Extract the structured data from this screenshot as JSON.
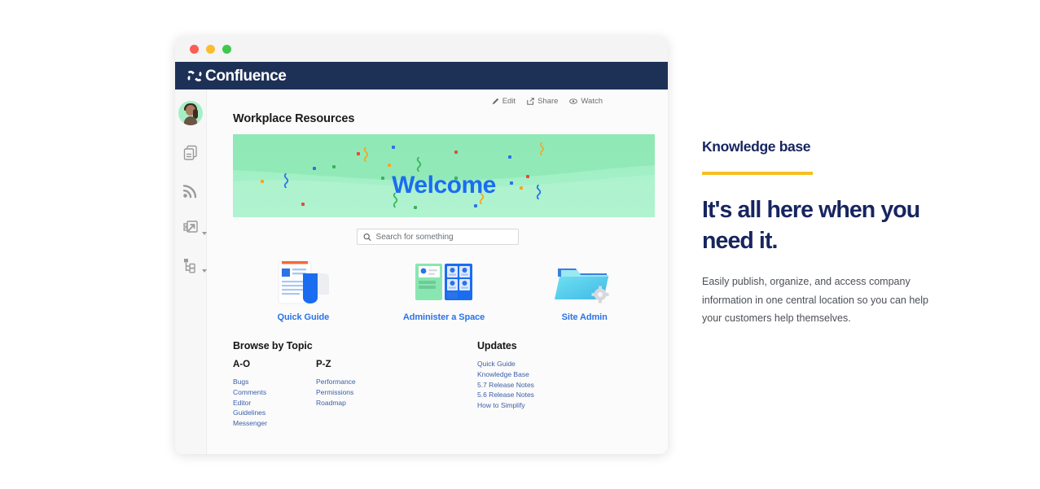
{
  "window": {
    "traffic_lights": [
      "close",
      "minimize",
      "maximize"
    ],
    "app_name": "Confluence"
  },
  "rail": {
    "items": [
      {
        "name": "user-avatar",
        "label": "User avatar"
      },
      {
        "name": "pages-icon",
        "label": "Pages"
      },
      {
        "name": "feed-icon",
        "label": "Feed"
      },
      {
        "name": "export-icon",
        "label": "Export"
      },
      {
        "name": "page-tree-icon",
        "label": "Page tree"
      }
    ]
  },
  "page": {
    "title": "Workplace Resources",
    "tools": [
      {
        "label": "Edit",
        "icon": "pencil-icon"
      },
      {
        "label": "Share",
        "icon": "share-icon"
      },
      {
        "label": "Watch",
        "icon": "eye-icon"
      }
    ]
  },
  "banner": {
    "text": "Welcome",
    "text_color": "#1a6df0",
    "bg_top": "#9ceec2",
    "bg_bottom": "#a9f1cb",
    "confetti_colors": [
      "#e8483c",
      "#2a73e8",
      "#f5a623",
      "#3bb35a"
    ]
  },
  "search": {
    "placeholder": "Search for something",
    "value": "",
    "icon": "search-icon"
  },
  "tiles": [
    {
      "label": "Quick Guide",
      "icon": "document-guide-icon"
    },
    {
      "label": "Administer a Space",
      "icon": "space-admin-icon"
    },
    {
      "label": "Site Admin",
      "icon": "folder-gear-icon"
    }
  ],
  "browse": {
    "title": "Browse by Topic",
    "columns": [
      {
        "heading": "A-O",
        "links": [
          "Bugs",
          "Comments",
          "Editor",
          "Guidelines",
          "Messenger"
        ]
      },
      {
        "heading": "P-Z",
        "links": [
          "Performance",
          "Permissions",
          "Roadmap"
        ]
      }
    ]
  },
  "updates": {
    "title": "Updates",
    "links": [
      "Quick Guide",
      "Knowledge Base",
      "5.7 Release Notes",
      "5.6 Release Notes",
      "How to Simplify"
    ]
  },
  "promo": {
    "eyebrow": "Knowledge base",
    "rule_color": "#f5c024",
    "heading": "It's all here when you need it.",
    "body": "Easily publish, organize, and access company information in one central location so you can help your customers help themselves.",
    "text_color": "#17255f"
  }
}
